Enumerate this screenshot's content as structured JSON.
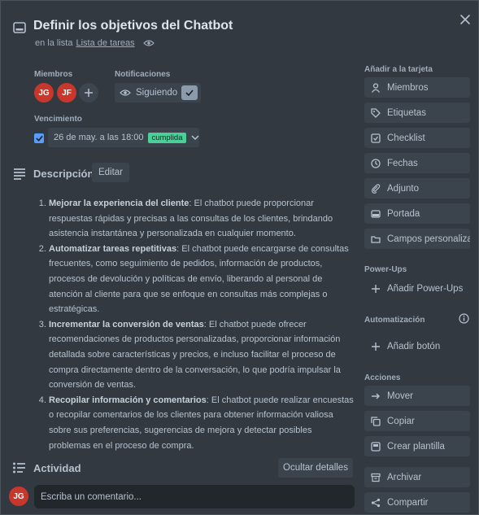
{
  "card": {
    "title": "Definir los objetivos del Chatbot",
    "list_prefix": "en la lista",
    "list_name": "Lista de tareas"
  },
  "members": {
    "label": "Miembros",
    "avatars": [
      "JG",
      "JF"
    ],
    "avatar_color": "#c9372c"
  },
  "notifications": {
    "label": "Notificaciones",
    "follow_label": "Siguiendo"
  },
  "due": {
    "label": "Vencimiento",
    "date_text": "26 de may. a las 18:00",
    "status_badge": "cumplida",
    "badge_color": "#4bce97"
  },
  "description": {
    "title": "Descripción",
    "edit_label": "Editar",
    "items": [
      {
        "bold": "Mejorar la experiencia del cliente",
        "text": ": El chatbot puede proporcionar respuestas rápidas y precisas a las consultas de los clientes, brindando asistencia instantánea y personalizada en cualquier momento."
      },
      {
        "bold": "Automatizar tareas repetitivas",
        "text": ": El chatbot puede encargarse de consultas frecuentes, como seguimiento de pedidos, información de productos, procesos de devolución y políticas de envío, liberando al personal de atención al cliente para que se enfoque en consultas más complejas o estratégicas."
      },
      {
        "bold": "Incrementar la conversión de ventas",
        "text": ": El chatbot puede ofrecer recomendaciones de productos personalizadas, proporcionar información detallada sobre características y precios, e incluso facilitar el proceso de compra directamente dentro de la conversación, lo que podría impulsar la conversión de ventas."
      },
      {
        "bold": "Recopilar información y comentarios",
        "text": ": El chatbot puede realizar encuestas o recopilar comentarios de los clientes para obtener información valiosa sobre sus preferencias, sugerencias de mejora y detectar posibles problemas en el proceso de compra."
      }
    ]
  },
  "activity": {
    "title": "Actividad",
    "hide_details_label": "Ocultar detalles",
    "user_initials": "JG",
    "comment_placeholder": "Escriba un comentario..."
  },
  "sidebar": {
    "add_to_card_title": "Añadir a la tarjeta",
    "add_to_card": [
      {
        "label": "Miembros",
        "icon": "user-icon"
      },
      {
        "label": "Etiquetas",
        "icon": "tag-icon"
      },
      {
        "label": "Checklist",
        "icon": "checklist-icon"
      },
      {
        "label": "Fechas",
        "icon": "clock-icon"
      },
      {
        "label": "Adjunto",
        "icon": "paperclip-icon"
      },
      {
        "label": "Portada",
        "icon": "cover-icon"
      },
      {
        "label": "Campos personaliza...",
        "icon": "custom-fields-icon"
      }
    ],
    "powerups_title": "Power-Ups",
    "add_powerups_label": "Añadir Power-Ups",
    "automation_title": "Automatización",
    "add_button_label": "Añadir botón",
    "actions_title": "Acciones",
    "actions": [
      {
        "label": "Mover",
        "icon": "arrow-right-icon"
      },
      {
        "label": "Copiar",
        "icon": "copy-icon"
      },
      {
        "label": "Crear plantilla",
        "icon": "template-icon"
      },
      {
        "label": "Archivar",
        "icon": "archive-icon"
      },
      {
        "label": "Compartir",
        "icon": "share-icon"
      }
    ]
  },
  "colors": {
    "background": "#323940",
    "button": "#3b444c",
    "text": "#b6c2cf",
    "accent_blue": "#579dff"
  }
}
